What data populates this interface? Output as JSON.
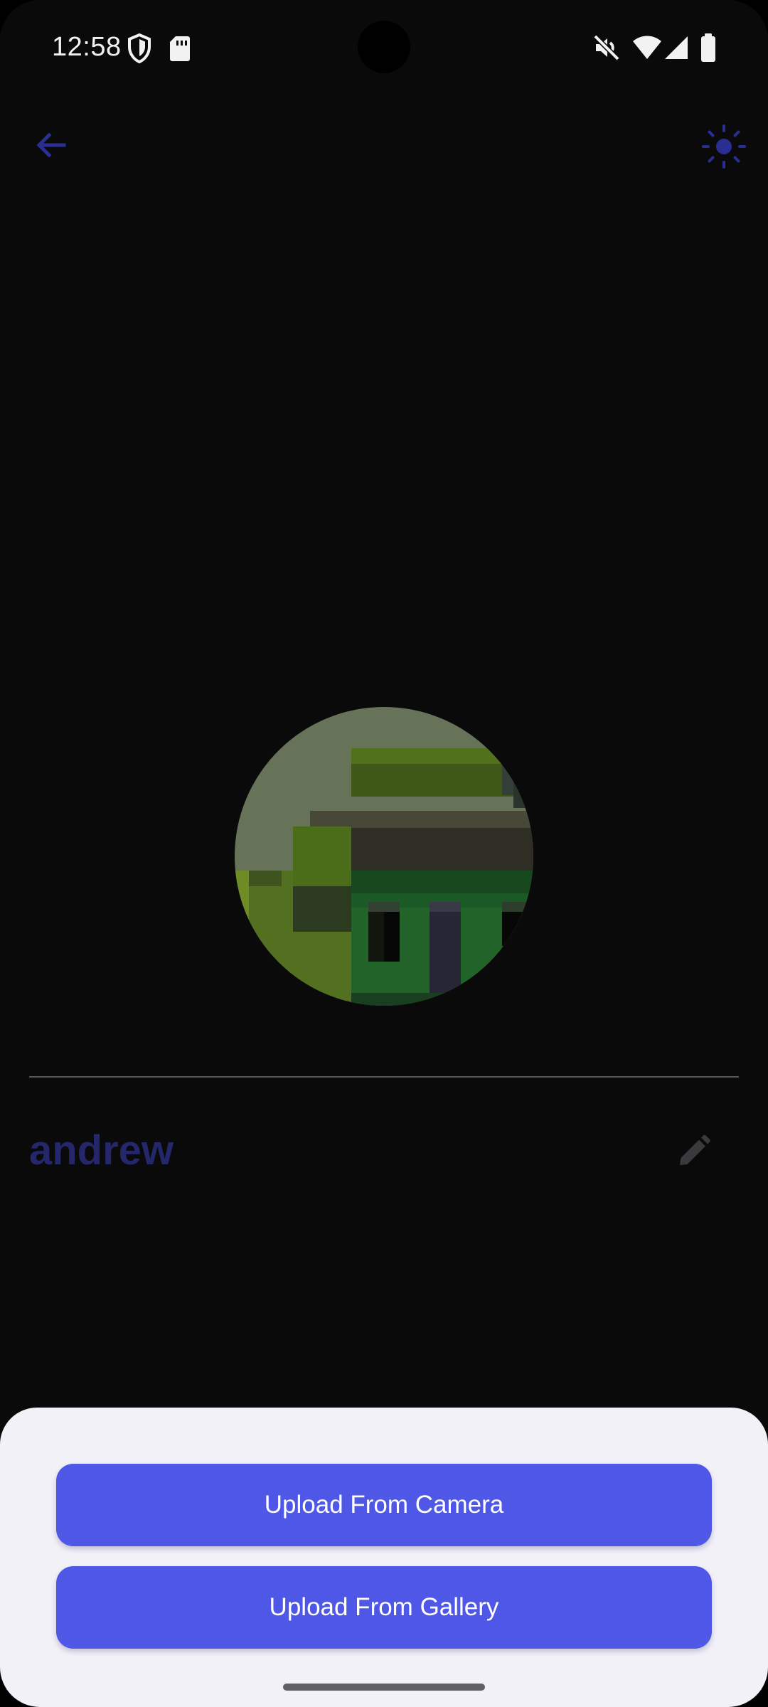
{
  "status_bar": {
    "time": "12:58",
    "icons": [
      "shield-icon",
      "sd-card-icon",
      "muted-volume-icon",
      "wifi-icon",
      "cellular-signal-icon",
      "battery-icon"
    ]
  },
  "app_bar": {
    "back_icon": "arrow-back-icon",
    "theme_icon": "sun-icon",
    "accent_color": "#2a2e92"
  },
  "profile": {
    "avatar_icon": "pixel-art-avatar",
    "username": "andrew",
    "edit_icon": "pencil-icon"
  },
  "bottom_sheet": {
    "camera_button_label": "Upload From Camera",
    "gallery_button_label": "Upload From Gallery",
    "button_color": "#4f58e6",
    "background_color": "#f3f1f8"
  }
}
